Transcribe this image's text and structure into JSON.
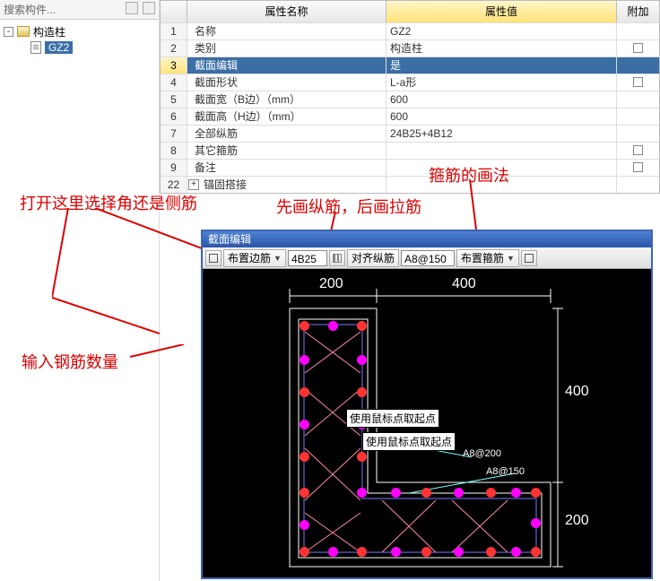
{
  "search_placeholder": "搜索构件...",
  "tree": {
    "root": "构造柱",
    "child": "GZ2"
  },
  "prop_headers": {
    "name": "属性名称",
    "value": "属性值",
    "add": "附加"
  },
  "rows": [
    {
      "n": "1",
      "name": "名称",
      "val": "GZ2",
      "link": true,
      "cb": false
    },
    {
      "n": "2",
      "name": "类别",
      "val": "构造柱",
      "link": true,
      "cb": true
    },
    {
      "n": "3",
      "name": "截面编辑",
      "val": "是",
      "sel": true
    },
    {
      "n": "4",
      "name": "截面形状",
      "val": "L-a形",
      "link": true,
      "cb": true
    },
    {
      "n": "5",
      "name": "截面宽（B边）（mm）",
      "val": "600",
      "gray": true
    },
    {
      "n": "6",
      "name": "截面高（H边）（mm）",
      "val": "600",
      "gray": true
    },
    {
      "n": "7",
      "name": "全部纵筋",
      "val": "24B25+4B12",
      "gray": true
    },
    {
      "n": "8",
      "name": "其它箍筋",
      "val": "",
      "link": true,
      "cb": true
    },
    {
      "n": "9",
      "name": "备注",
      "val": "",
      "link": true,
      "cb": true
    },
    {
      "n": "22",
      "name": "锚固搭接",
      "val": "",
      "gray": true,
      "last": true
    }
  ],
  "anno": {
    "a1": "打开这里选择角还是侧筋",
    "a2": "先画纵筋，后画拉筋",
    "a3": "箍筋的画法",
    "a4": "输入钢筋数量"
  },
  "editor": {
    "title": "截面编辑",
    "btn_bianjin": "布置边筋",
    "val_rebar": "4B25",
    "btn_align": "对齐纵筋",
    "val_stirrup": "A8@150",
    "btn_stirrup": "布置箍筋",
    "dims": {
      "w1": "200",
      "w2": "400",
      "h1": "400",
      "h2": "200"
    },
    "tip1": "使用鼠标点取起点",
    "tip2": "使用鼠标点取起点",
    "cyan1": "A8@200",
    "cyan2": "A8@150"
  },
  "chart_data": {
    "type": "diagram",
    "shape": "L-a",
    "outer_width": 600,
    "outer_height": 600,
    "leg_width": 200,
    "corner_height": 200,
    "top_span": 400,
    "right_span": 400,
    "longitudinal_bars": "24B25+4B12",
    "stirrups": [
      "A8@200",
      "A8@150"
    ]
  }
}
